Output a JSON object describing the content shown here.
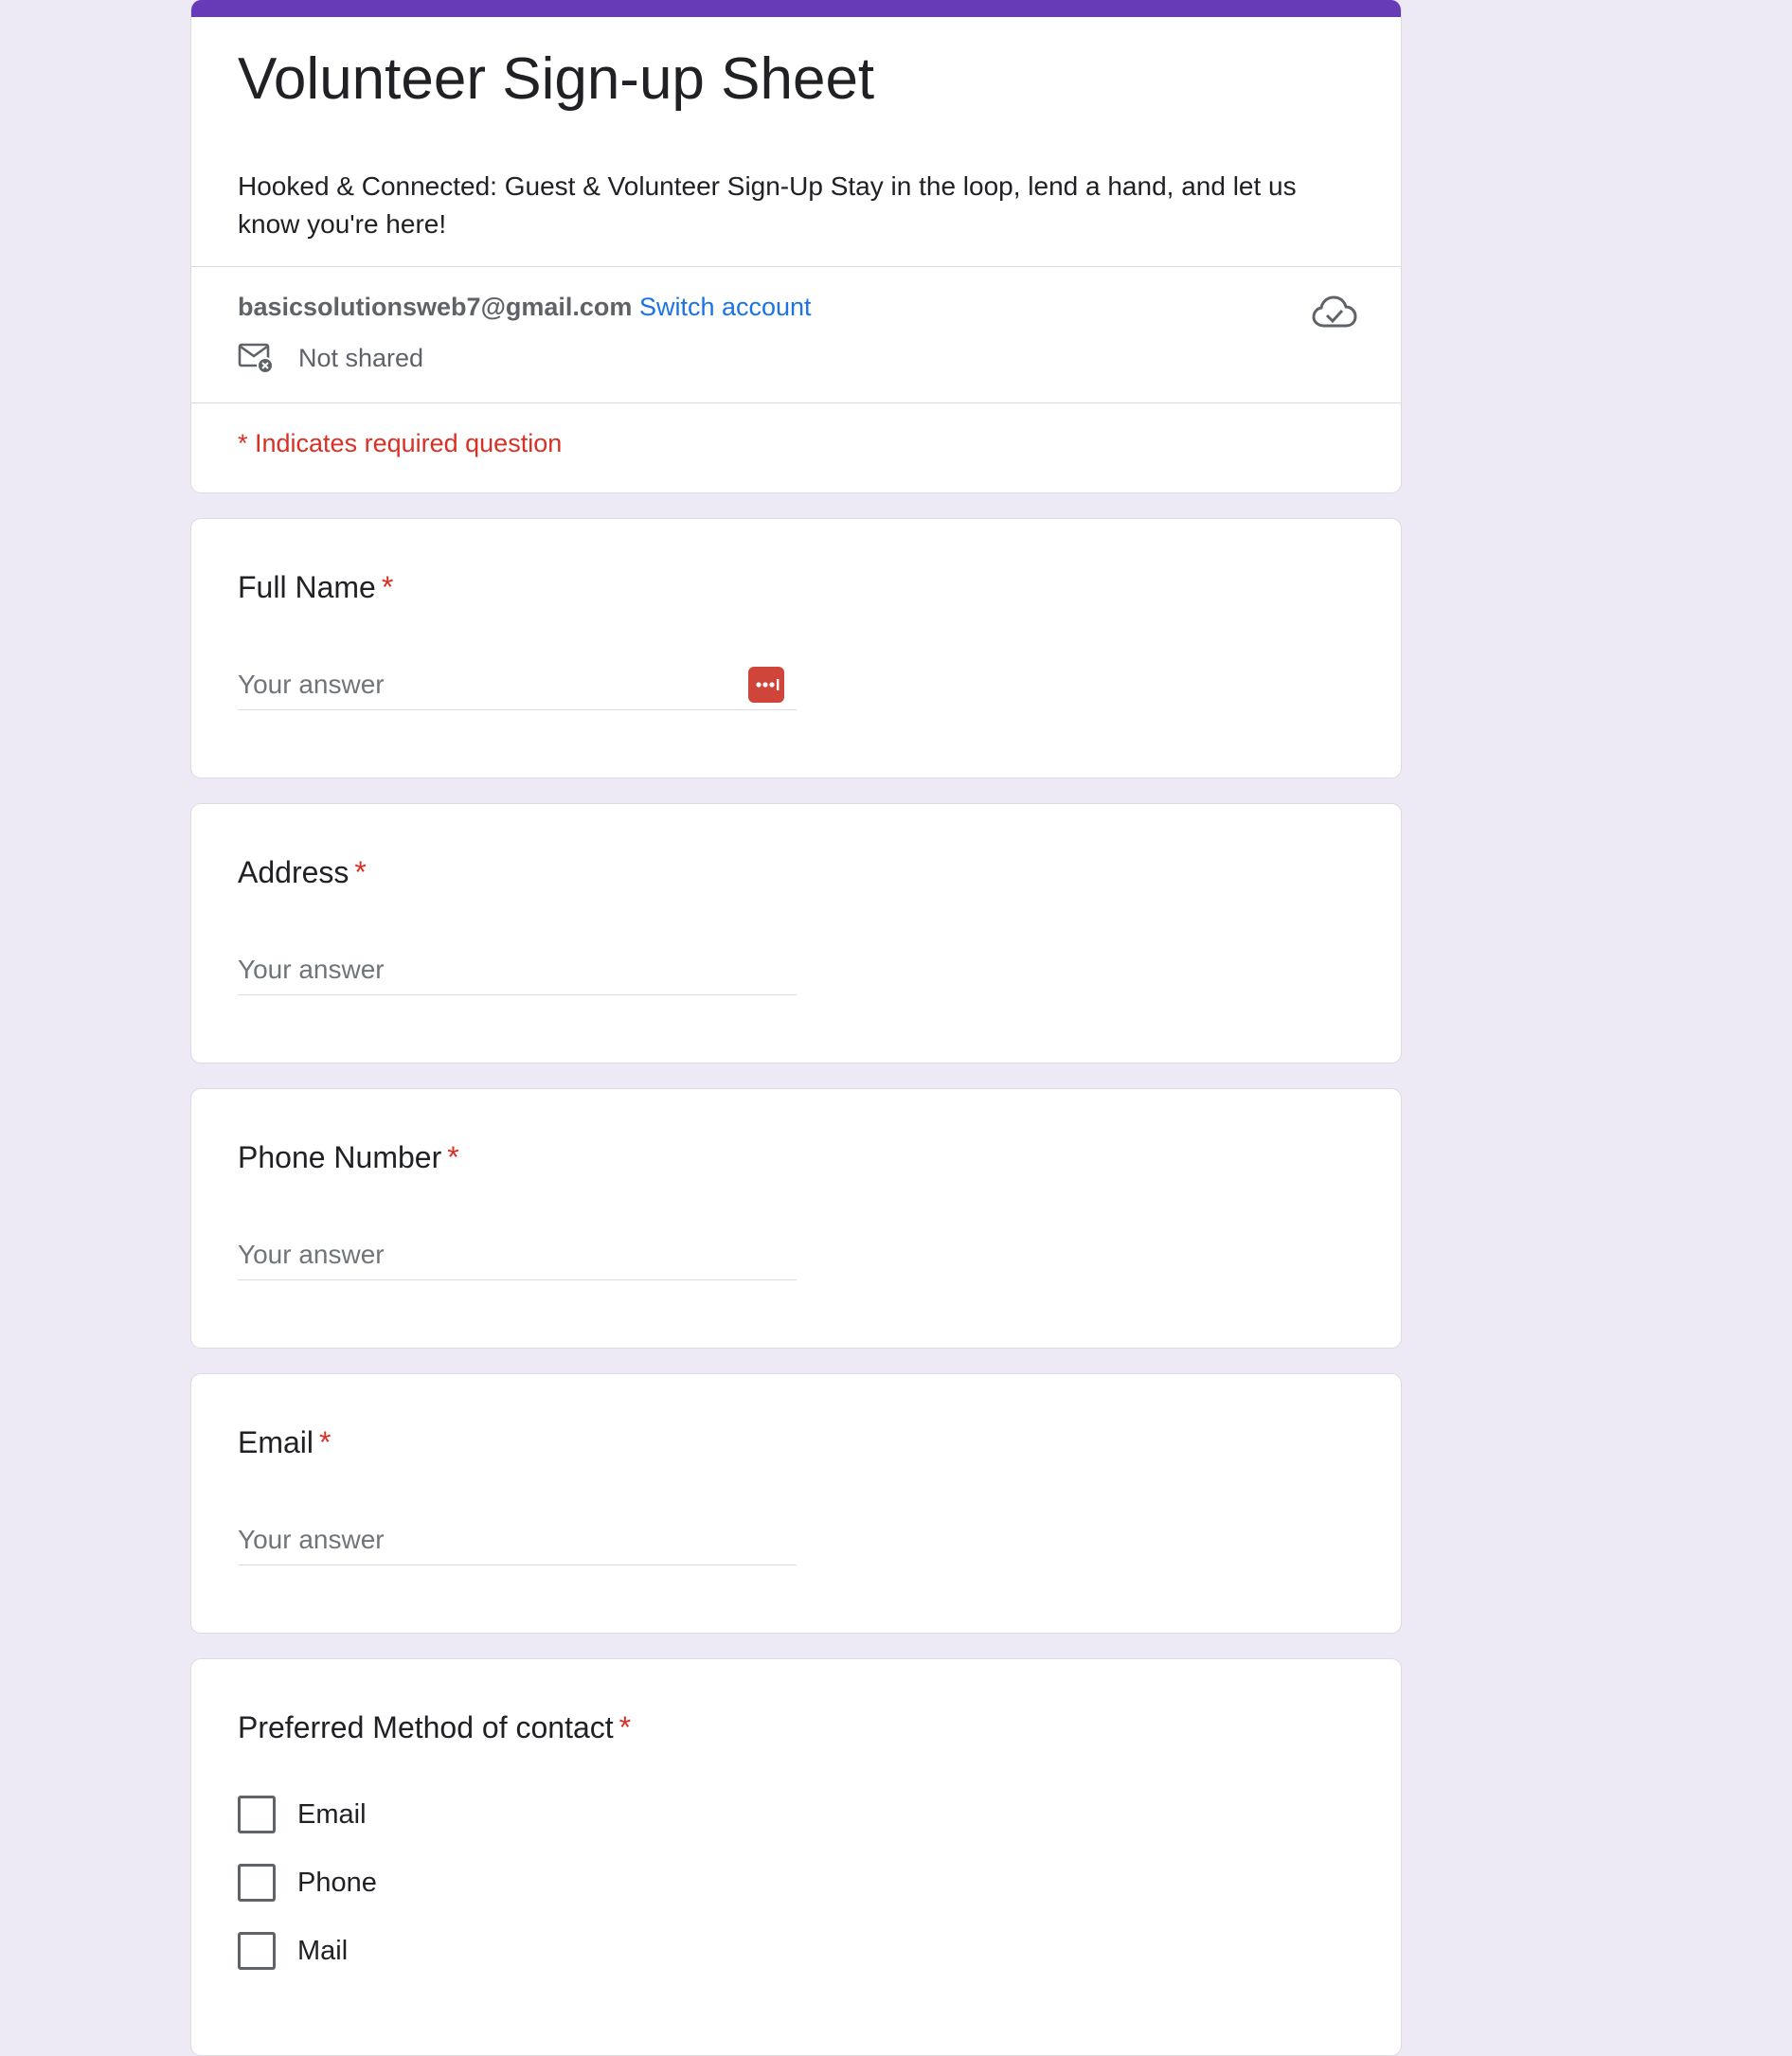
{
  "header": {
    "title": "Volunteer Sign-up Sheet",
    "description": "Hooked & Connected: Guest & Volunteer Sign-Up Stay in the loop, lend a hand, and let us know you're here!",
    "accent_color": "#673ab7"
  },
  "account": {
    "email": "basicsolutionsweb7@gmail.com",
    "switch_label": "Switch account",
    "shared_status": "Not shared",
    "shared_icon": "mail-not-shared-icon",
    "cloud_icon": "cloud-saved-icon"
  },
  "required_note": "* Indicates required question",
  "questions": [
    {
      "title": "Full Name",
      "required_mark": "*",
      "placeholder": "Your answer"
    },
    {
      "title": "Address",
      "required_mark": "*",
      "placeholder": "Your answer"
    },
    {
      "title": "Phone Number",
      "required_mark": "*",
      "placeholder": "Your answer"
    },
    {
      "title": "Email",
      "required_mark": "*",
      "placeholder": "Your answer"
    }
  ],
  "contact_question": {
    "title": "Preferred Method of contact",
    "required_mark": "*",
    "options": [
      "Email",
      "Phone",
      "Mail"
    ]
  },
  "colors": {
    "background": "#ede9f5",
    "required": "#d93025",
    "link": "#1a73e8",
    "password_manager": "#d0453a"
  }
}
